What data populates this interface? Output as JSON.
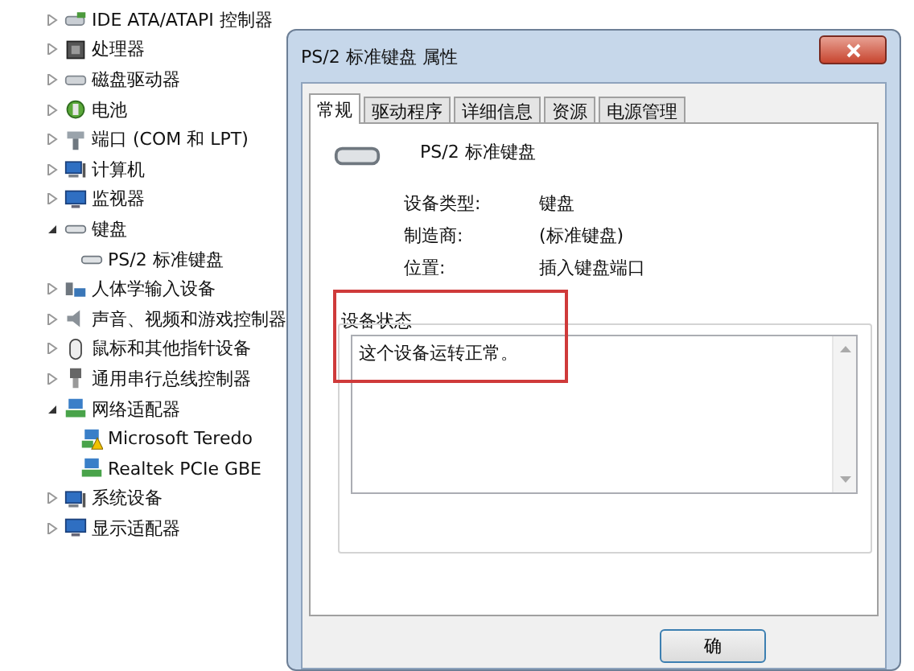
{
  "device_tree": [
    {
      "label": "IDE ATA/ATAPI 控制器",
      "kind": "controller",
      "expanded": false
    },
    {
      "label": "处理器",
      "kind": "chip",
      "expanded": false
    },
    {
      "label": "磁盘驱动器",
      "kind": "drive",
      "expanded": false
    },
    {
      "label": "电池",
      "kind": "battery",
      "expanded": false
    },
    {
      "label": "端口 (COM 和 LPT)",
      "kind": "port",
      "expanded": false
    },
    {
      "label": "计算机",
      "kind": "computer",
      "expanded": false
    },
    {
      "label": "监视器",
      "kind": "monitor",
      "expanded": false
    },
    {
      "label": "键盘",
      "kind": "keyboard",
      "expanded": true,
      "children": [
        {
          "label": "PS/2 标准键盘",
          "kind": "keyboard"
        }
      ]
    },
    {
      "label": "人体学输入设备",
      "kind": "hid",
      "expanded": false
    },
    {
      "label": "声音、视频和游戏控制器",
      "kind": "sound",
      "expanded": false
    },
    {
      "label": "鼠标和其他指针设备",
      "kind": "mouse",
      "expanded": false
    },
    {
      "label": "通用串行总线控制器",
      "kind": "usb",
      "expanded": false
    },
    {
      "label": "网络适配器",
      "kind": "network",
      "expanded": true,
      "children": [
        {
          "label": "Microsoft Teredo",
          "kind": "network-warning"
        },
        {
          "label": "Realtek PCIe GBE",
          "kind": "network"
        }
      ]
    },
    {
      "label": "系统设备",
      "kind": "computer",
      "expanded": false
    },
    {
      "label": "显示适配器",
      "kind": "monitor",
      "expanded": false
    }
  ],
  "dialog": {
    "title": "PS/2 标准键盘 属性",
    "tabs": [
      {
        "label": "常规",
        "selected": true
      },
      {
        "label": "驱动程序",
        "selected": false
      },
      {
        "label": "详细信息",
        "selected": false
      },
      {
        "label": "资源",
        "selected": false
      },
      {
        "label": "电源管理",
        "selected": false
      }
    ],
    "device_name": "PS/2 标准键盘",
    "properties": [
      {
        "label": "设备类型:",
        "value": "键盘"
      },
      {
        "label": "制造商:",
        "value": "(标准键盘)"
      },
      {
        "label": "位置:",
        "value": "插入键盘端口"
      }
    ],
    "status": {
      "title": "设备状态",
      "text": "这个设备运转正常。"
    },
    "buttons": [
      "确"
    ]
  }
}
